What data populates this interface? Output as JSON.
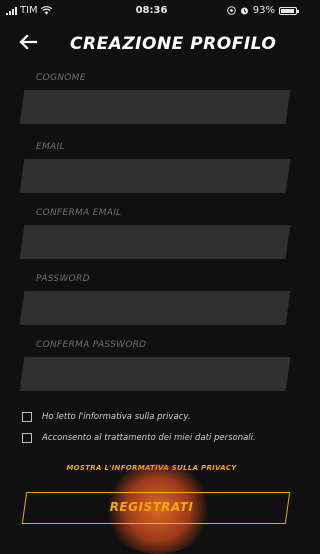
{
  "status_bar": {
    "carrier": "TIM",
    "time": "08:36",
    "battery": "93%",
    "battery_level": 0.93
  },
  "header": {
    "title": "CREAZIONE PROFILO"
  },
  "form": {
    "fields": [
      {
        "label": "COGNOME",
        "value": ""
      },
      {
        "label": "EMAIL",
        "value": ""
      },
      {
        "label": "CONFERMA EMAIL",
        "value": ""
      },
      {
        "label": "PASSWORD",
        "value": ""
      },
      {
        "label": "CONFERMA PASSWORD",
        "value": ""
      }
    ],
    "checkboxes": [
      {
        "label": "Ho letto l'informativa sulla privacy.",
        "checked": false
      },
      {
        "label": "Acconsento al trattamento dei miei dati personali.",
        "checked": false
      }
    ],
    "privacy_link": "MOSTRA L'INFORMATIVA SULLA PRIVACY",
    "submit_label": "REGISTRATI"
  },
  "colors": {
    "background": "#101010",
    "accent": "#f2a900",
    "input_bg": "#303030",
    "tap_highlight": "#e65a1e"
  }
}
